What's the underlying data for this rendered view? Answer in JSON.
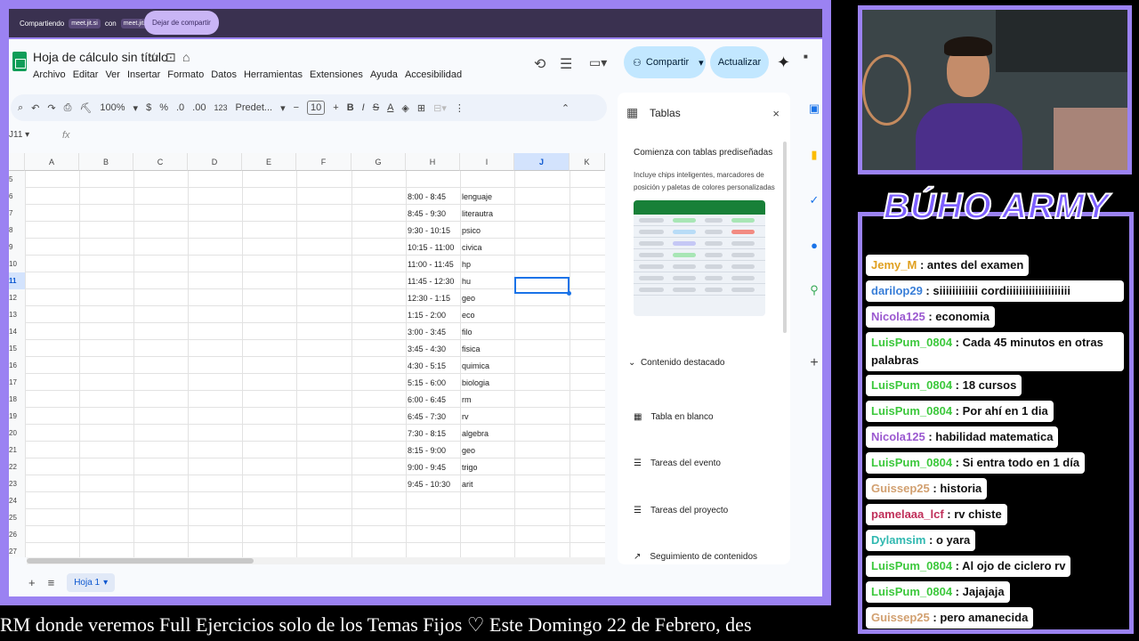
{
  "share_bar": {
    "sharing": "Compartiendo",
    "app1": "meet.jit.si",
    "with": "con",
    "app2": "meet.jit.si",
    "stop": "Dejar de compartir"
  },
  "sheets": {
    "title": "Hoja de cálculo sin título",
    "menus": [
      "Archivo",
      "Editar",
      "Ver",
      "Insertar",
      "Formato",
      "Datos",
      "Herramientas",
      "Extensiones",
      "Ayuda",
      "Accesibilidad"
    ],
    "share_label": "Compartir",
    "update_label": "Actualizar",
    "toolbar": {
      "zoom": "100%",
      "currency": "$",
      "percent": "%",
      "dec_minus": ".0",
      "dec_plus": ".00",
      "number_format": "123",
      "font": "Predet...",
      "font_size": "10"
    },
    "name_box": "J11",
    "fx": "fx",
    "columns": [
      "A",
      "B",
      "C",
      "D",
      "E",
      "F",
      "G",
      "H",
      "I",
      "J",
      "K"
    ],
    "selected_column": "J",
    "rows": [
      {
        "n": "5",
        "h": "",
        "i": ""
      },
      {
        "n": "6",
        "h": "8:00 - 8:45",
        "i": "lenguaje"
      },
      {
        "n": "7",
        "h": "8:45 - 9:30",
        "i": "literautra"
      },
      {
        "n": "8",
        "h": "9:30 - 10:15",
        "i": "psico"
      },
      {
        "n": "9",
        "h": "10:15 - 11:00",
        "i": "civica"
      },
      {
        "n": "10",
        "h": "11:00 - 11:45",
        "i": "hp"
      },
      {
        "n": "11",
        "h": "11:45 - 12:30",
        "i": "hu"
      },
      {
        "n": "12",
        "h": "12:30 - 1:15",
        "i": "geo"
      },
      {
        "n": "13",
        "h": "1:15 - 2:00",
        "i": "eco"
      },
      {
        "n": "14",
        "h": "3:00 - 3:45",
        "i": "filo"
      },
      {
        "n": "15",
        "h": "3:45 - 4:30",
        "i": "fisica"
      },
      {
        "n": "16",
        "h": "4:30 - 5:15",
        "i": "quimica"
      },
      {
        "n": "17",
        "h": "5:15 - 6:00",
        "i": "biologia"
      },
      {
        "n": "18",
        "h": "6:00 - 6:45",
        "i": "rm"
      },
      {
        "n": "19",
        "h": "6:45 - 7:30",
        "i": "rv"
      },
      {
        "n": "20",
        "h": "7:30 - 8:15",
        "i": "algebra"
      },
      {
        "n": "21",
        "h": "8:15 - 9:00",
        "i": "geo"
      },
      {
        "n": "22",
        "h": "9:00 - 9:45",
        "i": "trigo"
      },
      {
        "n": "23",
        "h": "9:45 - 10:30",
        "i": "arit"
      },
      {
        "n": "24",
        "h": "",
        "i": ""
      },
      {
        "n": "25",
        "h": "",
        "i": ""
      },
      {
        "n": "26",
        "h": "",
        "i": ""
      },
      {
        "n": "27",
        "h": "",
        "i": ""
      }
    ],
    "selected_row": "11",
    "sheet_tab": "Hoja 1",
    "panel": {
      "title": "Tablas",
      "subtitle": "Comienza con tablas prediseñadas",
      "description": "Incluye chips inteligentes, marcadores de posición y paletas de colores personalizadas",
      "section": "Contenido destacado",
      "items": [
        "Tabla en blanco",
        "Tareas del evento",
        "Tareas del proyecto",
        "Seguimiento de contenidos"
      ]
    }
  },
  "brand": "BÚHO ARMY",
  "chat": [
    {
      "user": "Jemy_M",
      "color": "#e0a020",
      "text": ": antes del examen"
    },
    {
      "user": "darilop29",
      "color": "#3a7fd8",
      "text": ": siiiiiiiiiiii cordiiiiiiiiiiiiiiiiiiii"
    },
    {
      "user": "Nicola125",
      "color": "#9b59d0",
      "text": ": economia"
    },
    {
      "user": "LuisPum_0804",
      "color": "#3cc83c",
      "text": ": Cada 45 minutos en otras palabras"
    },
    {
      "user": "LuisPum_0804",
      "color": "#3cc83c",
      "text": ": 18 cursos"
    },
    {
      "user": "LuisPum_0804",
      "color": "#3cc83c",
      "text": ": Por ahí en 1 dia"
    },
    {
      "user": "Nicola125",
      "color": "#9b59d0",
      "text": ": habilidad matematica"
    },
    {
      "user": "LuisPum_0804",
      "color": "#3cc83c",
      "text": ": Si entra todo en 1 día"
    },
    {
      "user": "Guissep25",
      "color": "#d2a070",
      "text": ": historia"
    },
    {
      "user": "pamelaaa_lcf",
      "color": "#c0305a",
      "text": ": rv chiste"
    },
    {
      "user": "Dylamsim",
      "color": "#30b8b0",
      "text": ": o yara"
    },
    {
      "user": "LuisPum_0804",
      "color": "#3cc83c",
      "text": ": Al ojo de ciclero rv"
    },
    {
      "user": "LuisPum_0804",
      "color": "#3cc83c",
      "text": ": Jajajaja"
    },
    {
      "user": "Guissep25",
      "color": "#d2a070",
      "text": ": pero amanecida"
    }
  ],
  "ticker": "RM donde veremos Full Ejercicios solo de los Temas Fijos ♡     Este Domingo 22 de Febrero, des"
}
